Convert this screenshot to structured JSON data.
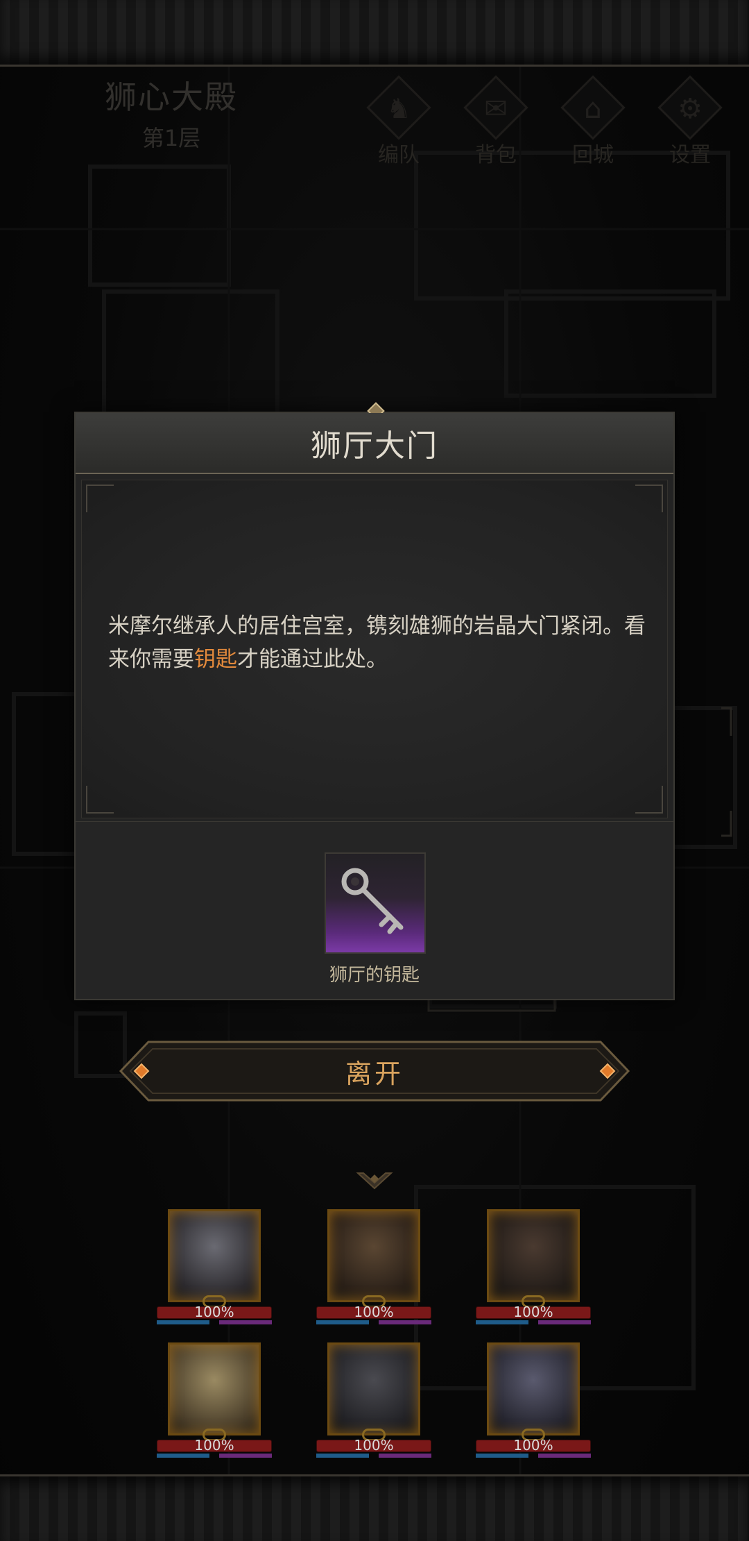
{
  "dungeon": {
    "name": "狮心大殿",
    "floor": "第1层"
  },
  "menu": [
    {
      "id": "team",
      "label": "编队",
      "icon": "helmet-icon",
      "glyph": "♞"
    },
    {
      "id": "bag",
      "label": "背包",
      "icon": "bag-icon",
      "glyph": "✉"
    },
    {
      "id": "return",
      "label": "回城",
      "icon": "door-icon",
      "glyph": "⌂"
    },
    {
      "id": "settings",
      "label": "设置",
      "icon": "gear-icon",
      "glyph": "⚙"
    }
  ],
  "dialog": {
    "title": "狮厅大门",
    "text_before": "米摩尔继承人的居住宫室，镌刻雄狮的岩晶大门紧闭。看来你需要",
    "text_highlight": "钥匙",
    "text_after": "才能通过此处。",
    "highlight_color": "#e38a3c",
    "item": {
      "name": "狮厅的钥匙",
      "icon": "key-icon",
      "rarity_color": "#7b3aa6"
    }
  },
  "leave_button": {
    "label": "离开"
  },
  "party": [
    {
      "hp": "100%",
      "portrait_tone": "#4a4a52"
    },
    {
      "hp": "100%",
      "portrait_tone": "#3a2a1c"
    },
    {
      "hp": "100%",
      "portrait_tone": "#2a2420"
    },
    {
      "hp": "100%",
      "portrait_tone": "#6a5a3c"
    },
    {
      "hp": "100%",
      "portrait_tone": "#2c2c30"
    },
    {
      "hp": "100%",
      "portrait_tone": "#3a3a4a"
    }
  ]
}
